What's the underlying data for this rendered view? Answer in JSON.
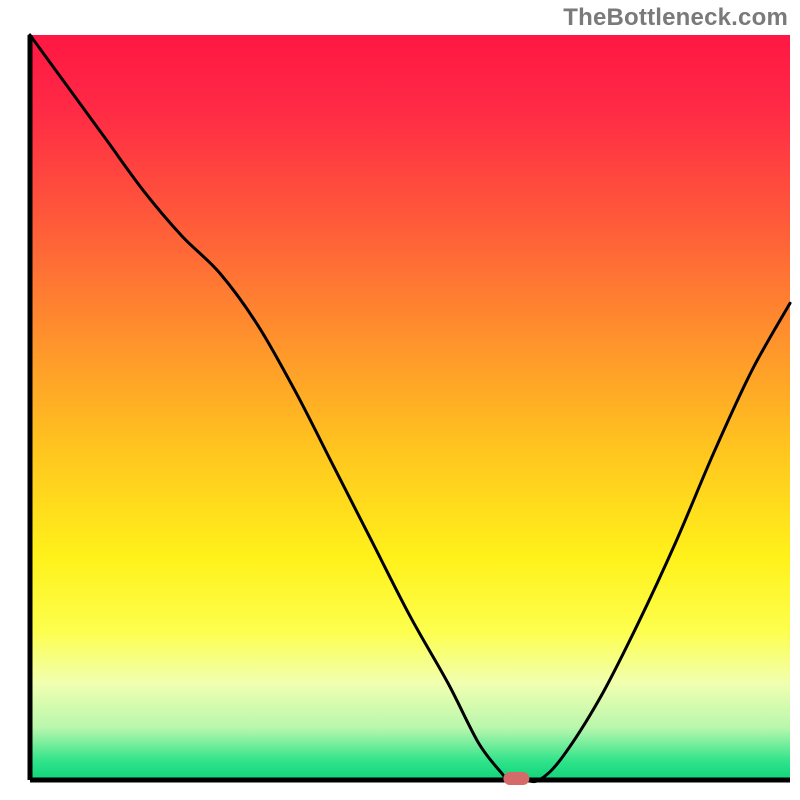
{
  "watermark": "TheBottleneck.com",
  "chart_data": {
    "type": "line",
    "title": "",
    "xlabel": "",
    "ylabel": "",
    "xlim": [
      0,
      100
    ],
    "ylim": [
      0,
      100
    ],
    "x": [
      0,
      5,
      10,
      15,
      20,
      25,
      30,
      35,
      40,
      45,
      50,
      55,
      59,
      62,
      63,
      65,
      67,
      70,
      75,
      80,
      85,
      90,
      95,
      100
    ],
    "y": [
      100,
      93,
      86,
      79,
      73,
      68,
      61,
      52,
      42,
      32,
      22,
      13,
      5,
      1,
      0,
      0,
      0,
      3,
      11,
      21,
      32,
      44,
      55,
      64
    ],
    "marker": {
      "x": 64,
      "y": 0,
      "color": "#d46a6a",
      "shape": "pill"
    },
    "gradient_stops": [
      {
        "offset": 0.0,
        "color": "#ff1744"
      },
      {
        "offset": 0.1,
        "color": "#ff2a45"
      },
      {
        "offset": 0.25,
        "color": "#ff5a3a"
      },
      {
        "offset": 0.4,
        "color": "#ff8f2d"
      },
      {
        "offset": 0.55,
        "color": "#ffc31f"
      },
      {
        "offset": 0.7,
        "color": "#fff11a"
      },
      {
        "offset": 0.8,
        "color": "#fdff4d"
      },
      {
        "offset": 0.87,
        "color": "#f1ffb0"
      },
      {
        "offset": 0.93,
        "color": "#b8f7ad"
      },
      {
        "offset": 0.975,
        "color": "#2fe38a"
      },
      {
        "offset": 1.0,
        "color": "#10d47a"
      }
    ],
    "axis_color": "#000000",
    "curve_color": "#000000"
  }
}
